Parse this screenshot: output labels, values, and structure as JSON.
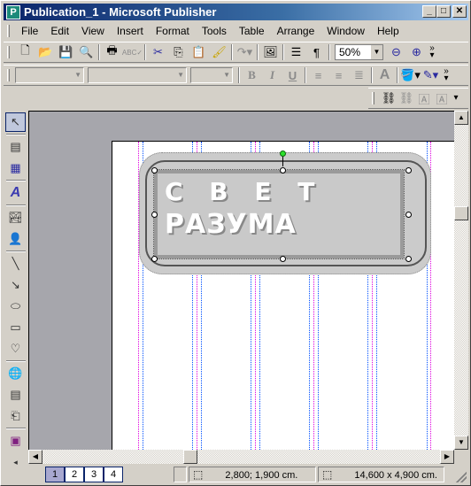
{
  "window": {
    "title": "Publication_1 - Microsoft Publisher",
    "app_icon": "publisher-icon"
  },
  "menu": [
    {
      "label": "File",
      "key": "F"
    },
    {
      "label": "Edit",
      "key": "E"
    },
    {
      "label": "View",
      "key": "V"
    },
    {
      "label": "Insert",
      "key": "I"
    },
    {
      "label": "Format",
      "key": "o"
    },
    {
      "label": "Tools",
      "key": "T"
    },
    {
      "label": "Table",
      "key": "a"
    },
    {
      "label": "Arrange",
      "key": "r"
    },
    {
      "label": "Window",
      "key": "W"
    },
    {
      "label": "Help",
      "key": "H"
    }
  ],
  "standard_toolbar": {
    "zoom": "50%",
    "icons": [
      "new-icon",
      "open-icon",
      "save-icon",
      "search-icon",
      "print-icon",
      "spelling-icon",
      "cut-icon",
      "copy-icon",
      "paste-icon",
      "format-painter-icon",
      "redo-icon",
      "insert-picture-icon",
      "columns-icon",
      "pilcrow-icon",
      "zoom-out-icon",
      "zoom-in-icon"
    ]
  },
  "formatting_toolbar": {
    "style": "",
    "font": "",
    "size": "",
    "bold": "B",
    "italic": "I",
    "underline": "U"
  },
  "canvas": {
    "text_line1": "С В Е Т",
    "text_line2": "РАЗУМА"
  },
  "status": {
    "pages": [
      "1",
      "2",
      "3",
      "4"
    ],
    "current_page": "1",
    "position": "2,800; 1,900 cm.",
    "size": "14,600 x    4,900 cm."
  }
}
